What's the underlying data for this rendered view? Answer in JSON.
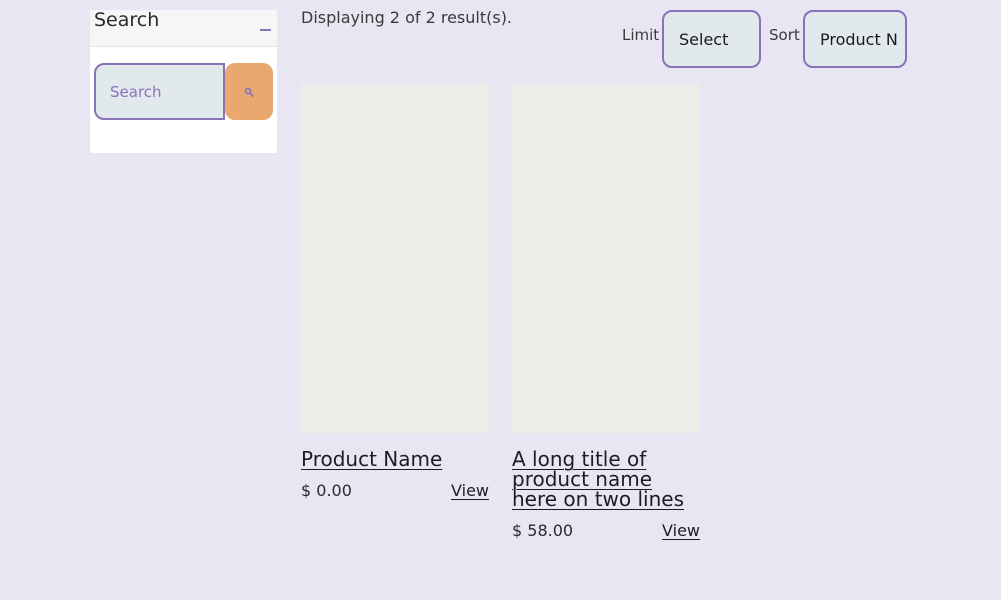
{
  "sidebar": {
    "title": "Search",
    "search_placeholder": "Search",
    "search_value": ""
  },
  "results": {
    "summary": "Displaying 2 of 2 result(s).",
    "limit_label": "Limit",
    "limit_value": "Select",
    "sort_label": "Sort",
    "sort_value": "Product N"
  },
  "products": [
    {
      "title": "Product Name",
      "price": "$ 0.00",
      "view_label": "View"
    },
    {
      "title": "A long title of product name here on two lines",
      "price": "$ 58.00",
      "view_label": "View"
    }
  ],
  "colors": {
    "page_background": "#e9e6f4",
    "accent_purple": "#8a72b8",
    "search_button": "#e8a870",
    "input_background": "#e2e9ec",
    "image_placeholder": "#eeece9"
  },
  "icons": {
    "collapse": "minus-icon",
    "search": "search-icon"
  }
}
